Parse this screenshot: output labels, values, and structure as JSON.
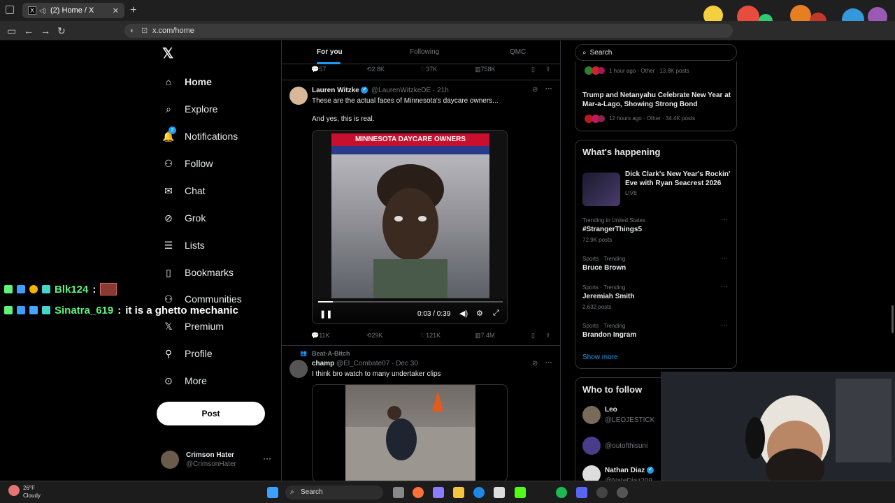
{
  "browser": {
    "tab_title": "(2) Home / X",
    "url": "x.com/home"
  },
  "nav": {
    "items": [
      {
        "label": "Home",
        "icon": "home-icon"
      },
      {
        "label": "Explore",
        "icon": "search-icon"
      },
      {
        "label": "Notifications",
        "icon": "bell-icon",
        "badge": "2"
      },
      {
        "label": "Follow",
        "icon": "person-add-icon"
      },
      {
        "label": "Chat",
        "icon": "mail-icon"
      },
      {
        "label": "Grok",
        "icon": "grok-icon"
      },
      {
        "label": "Lists",
        "icon": "list-icon"
      },
      {
        "label": "Bookmarks",
        "icon": "bookmark-icon"
      },
      {
        "label": "Communities",
        "icon": "people-icon"
      },
      {
        "label": "Premium",
        "icon": "x-icon"
      },
      {
        "label": "Profile",
        "icon": "person-icon"
      },
      {
        "label": "More",
        "icon": "more-circle-icon"
      }
    ],
    "post_label": "Post",
    "account": {
      "name": "Crimson Hater",
      "handle": "@CrimsonHater",
      "more": "···"
    }
  },
  "chat_overlay": [
    {
      "user": "Blk124",
      "sep": ":",
      "message": ""
    },
    {
      "user": "Sinatra_619",
      "sep": ":",
      "message": "it is a ghetto mechanic"
    }
  ],
  "feed": {
    "tabs": [
      "For you",
      "Following",
      "QMC"
    ],
    "prev_actions": {
      "replies": "57",
      "reposts": "2.8K",
      "likes": "37K",
      "views": "758K"
    },
    "tweet1": {
      "name": "Lauren Witzke",
      "handle": "@LaurenWitzkeDE",
      "time": "· 21h",
      "text1": "These are the actual faces of Minnesota's daycare owners...",
      "text2": "And yes, this is real.",
      "video_banner": "MINNESOTA DAYCARE OWNERS",
      "video_time": "0:03 / 0:39",
      "progress": 0.08,
      "actions": {
        "replies": "11K",
        "reposts": "29K",
        "likes": "121K",
        "views": "7.4M"
      }
    },
    "tweet2": {
      "context": "Beat-A-Bitch",
      "name": "champ",
      "handle": "@El_Combate07",
      "time": "· Dec 30",
      "text": "I think bro watch to many undertaker clips"
    }
  },
  "sidebar": {
    "search_placeholder": "Search",
    "top_panel": {
      "item1_meta": "1 hour ago · Other · 13.8K posts",
      "item2_title": "Trump and Netanyahu Celebrate New Year at Mar-a-Lago, Showing Strong Bond",
      "item2_meta": "12 hours ago · Other · 34.4K posts"
    },
    "whats_happening": {
      "title": "What's happening",
      "featured_title": "Dick Clark's New Year's Rockin' Eve with Ryan Seacrest 2026",
      "featured_status": "LIVE",
      "trends": [
        {
          "context": "Trending in United States",
          "name": "#StrangerThings5",
          "posts": "72.9K posts"
        },
        {
          "context": "Sports · Trending",
          "name": "Bruce Brown",
          "posts": ""
        },
        {
          "context": "Sports · Trending",
          "name": "Jeremiah Smith",
          "posts": "2,632 posts"
        },
        {
          "context": "Sports · Trending",
          "name": "Brandon Ingram",
          "posts": ""
        }
      ],
      "show_more": "Show more"
    },
    "who_to_follow": {
      "title": "Who to follow",
      "users": [
        {
          "name": "Leo",
          "handle": "@LEOJESTICK"
        },
        {
          "name": "",
          "handle": "@outofthisuni"
        },
        {
          "name": "Nathan Diaz",
          "handle": "@NateDiaz209"
        }
      ]
    }
  },
  "taskbar": {
    "temp": "26°F",
    "condition": "Cloudy",
    "search_label": "Search"
  }
}
